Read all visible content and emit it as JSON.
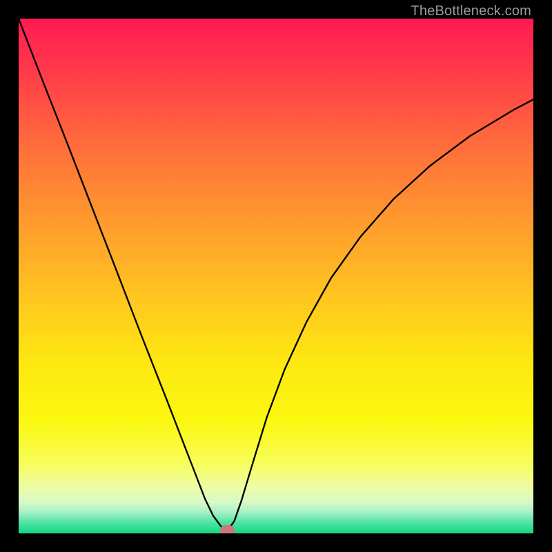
{
  "watermark": "TheBottleneck.com",
  "colors": {
    "frame": "#000000",
    "watermark": "#9b9b9b",
    "curve": "#000000",
    "marker": "#cb7876",
    "gradient_stops": [
      {
        "pct": 0,
        "hex": "#ff1a53"
      },
      {
        "pct": 10,
        "hex": "#ff3a4a"
      },
      {
        "pct": 25,
        "hex": "#ff6e3b"
      },
      {
        "pct": 40,
        "hex": "#ff9c2d"
      },
      {
        "pct": 55,
        "hex": "#ffc81f"
      },
      {
        "pct": 67,
        "hex": "#fde810"
      },
      {
        "pct": 78,
        "hex": "#fbf80f"
      },
      {
        "pct": 86,
        "hex": "#f8fd55"
      },
      {
        "pct": 91,
        "hex": "#eefca6"
      },
      {
        "pct": 94,
        "hex": "#d7f9c8"
      },
      {
        "pct": 96,
        "hex": "#a2f0c4"
      },
      {
        "pct": 98,
        "hex": "#4ce3a2"
      },
      {
        "pct": 100,
        "hex": "#12d884"
      }
    ]
  },
  "chart_data": {
    "type": "line",
    "title": "",
    "xlabel": "",
    "ylabel": "",
    "xlim": [
      0,
      100
    ],
    "ylim": [
      0,
      100
    ],
    "note": "Axes are unlabeled; x/y expressed as percentage of plot width/height (origin bottom-left). Values estimated from pixels.",
    "marker": {
      "x": 40.5,
      "y": 0.5
    },
    "series": [
      {
        "name": "left-branch",
        "x": [
          0.0,
          4.6,
          9.4,
          14.2,
          19.0,
          23.8,
          28.8,
          33.7,
          36.2,
          37.8,
          39.3,
          40.5
        ],
        "y": [
          100.0,
          88.1,
          75.9,
          63.5,
          51.1,
          38.6,
          25.9,
          13.2,
          6.7,
          3.4,
          1.4,
          0.4
        ]
      },
      {
        "name": "right-branch",
        "x": [
          40.5,
          41.9,
          43.3,
          45.5,
          48.2,
          51.7,
          55.9,
          60.7,
          66.4,
          72.8,
          79.9,
          87.7,
          96.2,
          100.0
        ],
        "y": [
          0.4,
          2.4,
          6.4,
          13.7,
          22.5,
          31.9,
          41.0,
          49.6,
          57.6,
          64.9,
          71.4,
          77.2,
          82.3,
          84.3
        ]
      }
    ]
  }
}
